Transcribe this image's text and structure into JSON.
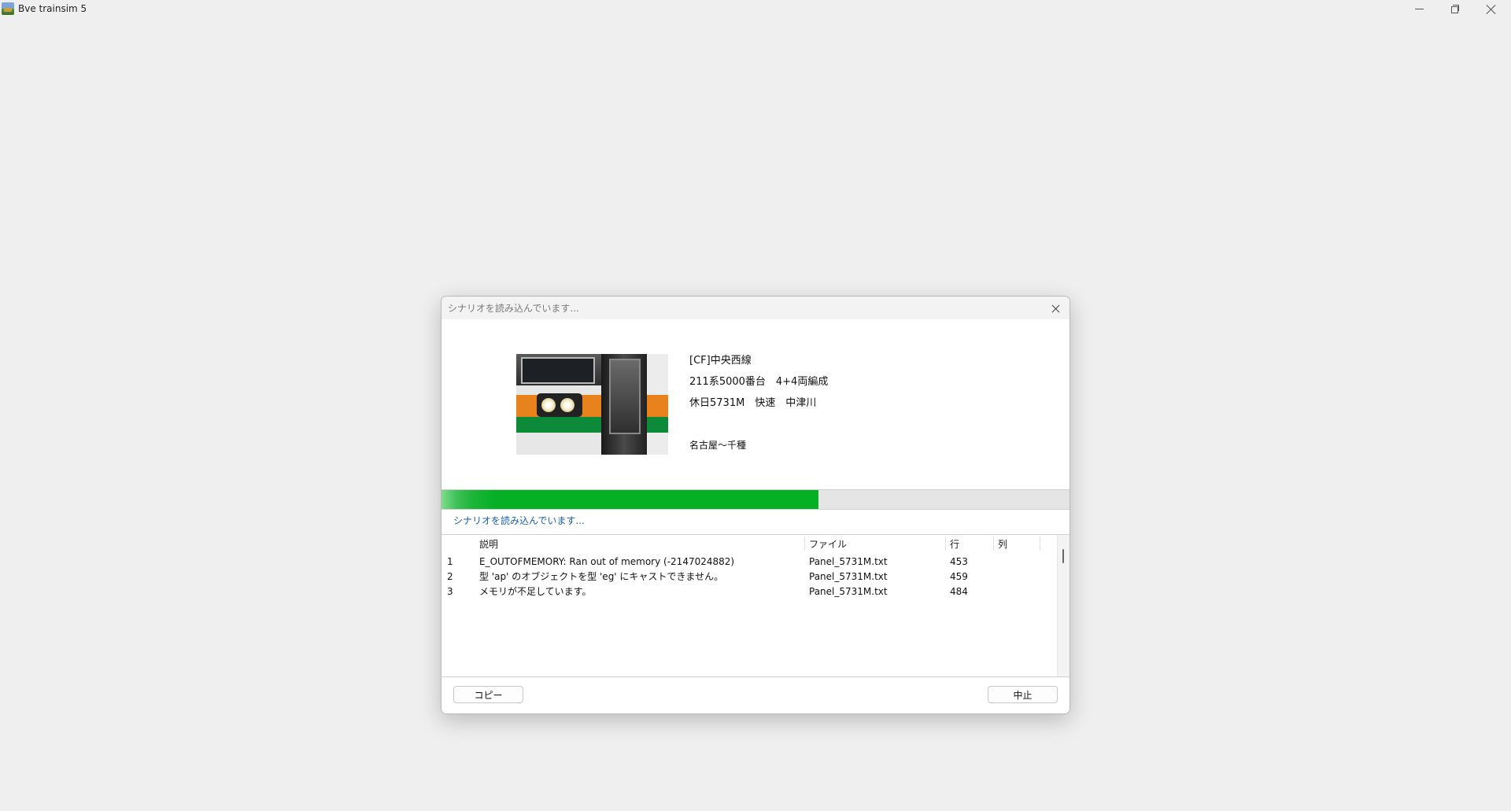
{
  "app": {
    "title": "Bve trainsim 5"
  },
  "dialog": {
    "title": "シナリオを読み込んでいます...",
    "scenario": {
      "route": "[CF]中央西線",
      "vehicle": "211系5000番台　4+4両編成",
      "train": "休日5731M　快速　中津川",
      "section": "名古屋～千種"
    },
    "progress": {
      "fraction": 0.6
    },
    "status": "シナリオを読み込んでいます...",
    "errors": {
      "columns": [
        "説明",
        "ファイル",
        "行",
        "列"
      ],
      "rows": [
        {
          "no": "1",
          "description": "E_OUTOFMEMORY: Ran out of memory (-2147024882)",
          "file": "Panel_5731M.txt",
          "line": "453",
          "col": ""
        },
        {
          "no": "2",
          "description": "型 'ap' のオブジェクトを型 'eg' にキャストできません。",
          "file": "Panel_5731M.txt",
          "line": "459",
          "col": ""
        },
        {
          "no": "3",
          "description": "メモリが不足しています。",
          "file": "Panel_5731M.txt",
          "line": "484",
          "col": ""
        }
      ]
    },
    "buttons": {
      "copy": "コピー",
      "cancel": "中止"
    }
  },
  "colors": {
    "progress": "#06b025",
    "status_text": "#1a5fb4",
    "background": "#efefef"
  },
  "icons": {
    "app": "train-app-icon",
    "minimize": "minimize-icon",
    "maximize": "restore-icon",
    "close": "close-icon"
  }
}
